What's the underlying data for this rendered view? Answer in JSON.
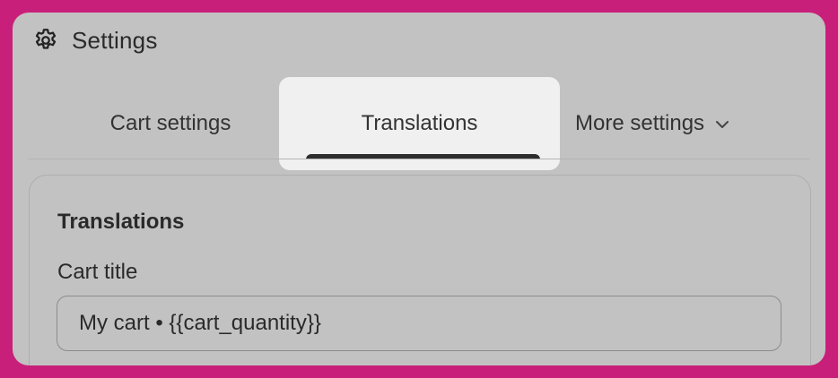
{
  "header": {
    "title": "Settings",
    "icon": "gear-icon"
  },
  "tabs": [
    {
      "label": "Cart settings",
      "active": false
    },
    {
      "label": "Translations",
      "active": true
    },
    {
      "label": "More settings",
      "active": false,
      "icon": "chevron-down-icon"
    }
  ],
  "section": {
    "title": "Translations",
    "fields": [
      {
        "label": "Cart title",
        "value": "My cart • {{cart_quantity}}"
      }
    ]
  },
  "colors": {
    "background": "#c8207a",
    "panel": "#c2c2c2",
    "active_tab": "#f0f0f0",
    "text": "#2a2a2a"
  }
}
